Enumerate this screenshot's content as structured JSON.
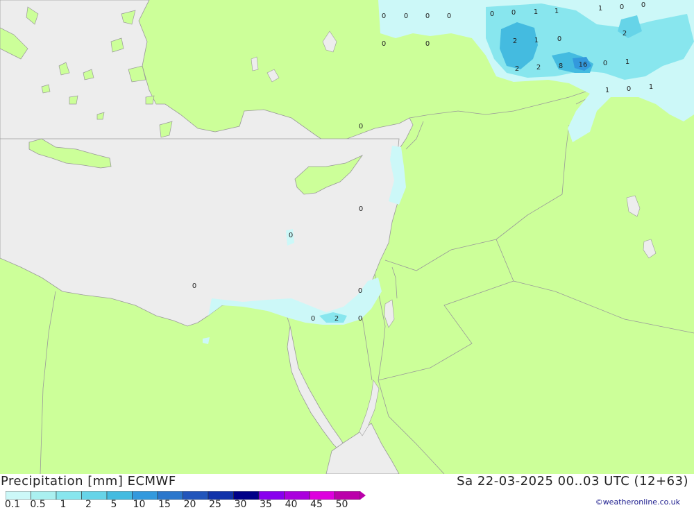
{
  "title": "Precipitation [mm] ECMWF",
  "datetime": "Sa 22-03-2025 00..03 UTC (12+63)",
  "credit": "©weatheronline.co.uk",
  "colors": {
    "land": "#ccff99",
    "sea": "#ededed",
    "border": "#999999"
  },
  "scale": {
    "labels": [
      "0.1",
      "0.5",
      "1",
      "2",
      "5",
      "10",
      "15",
      "20",
      "25",
      "30",
      "35",
      "40",
      "45",
      "50"
    ],
    "colors": [
      "#ccf8f8",
      "#aaf0f0",
      "#88e6ee",
      "#66d4e8",
      "#44bbe0",
      "#3399dd",
      "#2b77cc",
      "#2255bb",
      "#1133aa",
      "#000088",
      "#8800ee",
      "#aa00dd",
      "#dd00dd",
      "#bb00aa"
    ]
  },
  "values": [
    "0",
    "0",
    "0",
    "0",
    "0",
    "0",
    "1",
    "1",
    "1",
    "0",
    "0",
    "0",
    "0",
    "2",
    "1",
    "0",
    "2",
    "2",
    "2",
    "8",
    "16",
    "0",
    "1",
    "1",
    "0",
    "1",
    "0",
    "0",
    "0",
    "0",
    "0",
    "0",
    "2",
    "0"
  ]
}
